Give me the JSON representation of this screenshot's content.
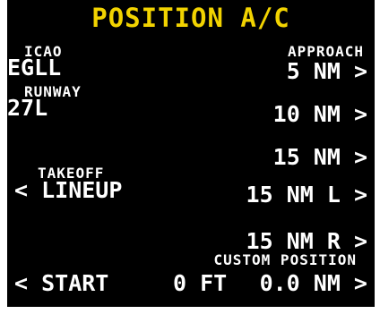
{
  "colors": {
    "background": "#000000",
    "title": "#f2d300",
    "text": "#ffffff"
  },
  "title": "POSITION A/C",
  "left": {
    "icao_label": "ICAO",
    "icao_value": "EGLL",
    "runway_label": "RUNWAY",
    "runway_value": "27L",
    "takeoff_label": "TAKEOFF",
    "lineup_button": "< LINEUP",
    "start_button": "< START"
  },
  "right": {
    "approach_label": "APPROACH",
    "approach_5": "5 NM >",
    "approach_10": "10 NM >",
    "approach_15": "15 NM >",
    "approach_15l": "15 NM L >",
    "approach_15r": "15 NM R >",
    "custom_label": "CUSTOM POSITION",
    "custom_alt": "0 FT",
    "custom_dist": "0.0 NM >"
  }
}
